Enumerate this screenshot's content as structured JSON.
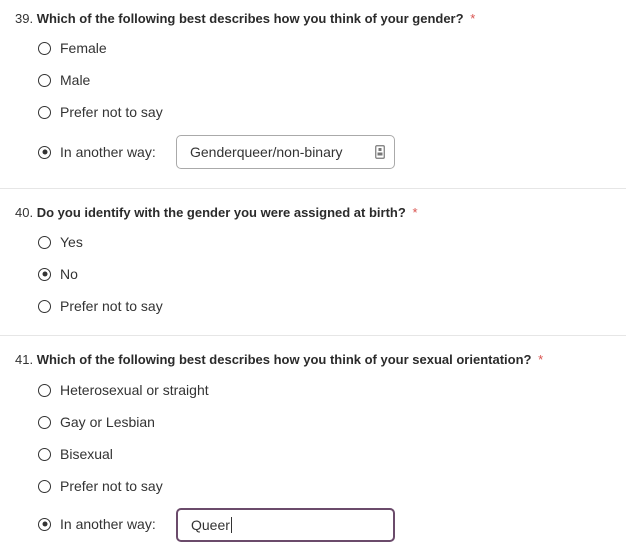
{
  "questions": [
    {
      "number": "39.",
      "text": "Which of the following best describes how you think of your gender?",
      "required_mark": "*",
      "options": [
        {
          "label": "Female",
          "checked": false
        },
        {
          "label": "Male",
          "checked": false
        },
        {
          "label": "Prefer not to say",
          "checked": false
        },
        {
          "label": "In another way:",
          "checked": true
        }
      ],
      "other_input": {
        "value": "Genderqueer/non-binary",
        "icon": "contact-card-icon"
      }
    },
    {
      "number": "40.",
      "text": "Do you identify with the gender you were assigned at birth?",
      "required_mark": "*",
      "options": [
        {
          "label": "Yes",
          "checked": false
        },
        {
          "label": "No",
          "checked": true
        },
        {
          "label": "Prefer not to say",
          "checked": false
        }
      ]
    },
    {
      "number": "41.",
      "text": "Which of the following best describes how you think of your sexual orientation?",
      "required_mark": "*",
      "options": [
        {
          "label": "Heterosexual or straight",
          "checked": false
        },
        {
          "label": "Gay or Lesbian",
          "checked": false
        },
        {
          "label": "Bisexual",
          "checked": false
        },
        {
          "label": "Prefer not to say",
          "checked": false
        },
        {
          "label": "In another way:",
          "checked": true
        }
      ],
      "other_input": {
        "value": "Queer",
        "focused": true
      }
    }
  ],
  "colors": {
    "required": "#d9534f",
    "focus_border": "#6b4b6b",
    "text": "#333333",
    "divider": "#e6e6e6"
  }
}
